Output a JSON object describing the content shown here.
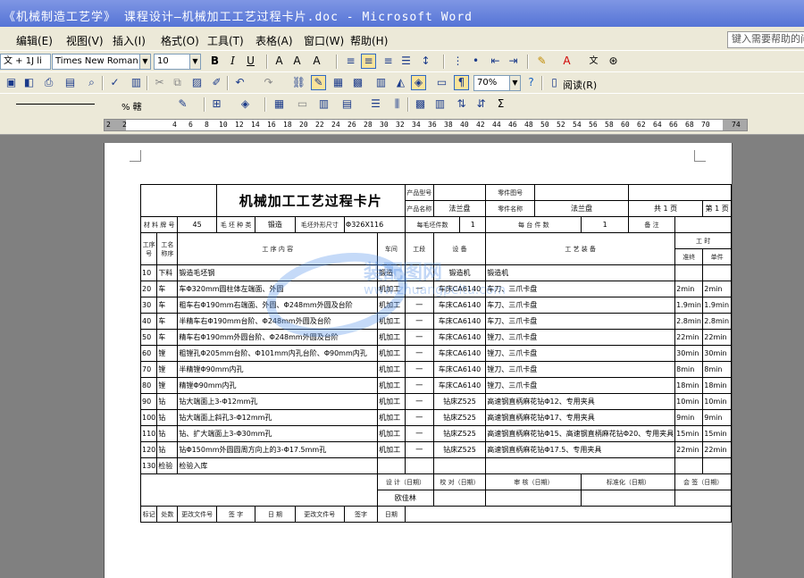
{
  "window": {
    "title": "《机械制造工艺学》 课程设计—机械加工工艺过程卡片.doc - Microsoft Word"
  },
  "menu": {
    "items": [
      "编辑(E)",
      "视图(V)",
      "插入(I)",
      "格式(O)",
      "工具(T)",
      "表格(A)",
      "窗口(W)",
      "帮助(H)"
    ],
    "help_placeholder": "键入需要帮助的问题"
  },
  "toolbar": {
    "style_value": "文 + 1J li",
    "font_value": "Times New Roman",
    "size_value": "10",
    "bold": "B",
    "italic": "I",
    "underline": "U",
    "zoom_value": "70%",
    "read_label": "阅读(R)",
    "draw_pct": "% 轄",
    "sigma": "Σ"
  },
  "ruler": {
    "ticks": [
      "2",
      "4",
      "6",
      "8",
      "10",
      "12",
      "14",
      "16",
      "18",
      "20",
      "22",
      "24",
      "26",
      "28",
      "30",
      "32",
      "34",
      "36",
      "38",
      "40",
      "42",
      "44",
      "46",
      "48",
      "50",
      "52",
      "54",
      "56",
      "58",
      "60",
      "62",
      "64",
      "66",
      "68",
      "70",
      "74"
    ]
  },
  "card": {
    "title": "机械加工工艺过程卡片",
    "product_model_label": "产品型号",
    "product_name_label": "产品名称",
    "product_name_value": "法兰盘",
    "part_no_label": "零件图号",
    "part_name_label": "零件名称",
    "part_name_value": "法兰盘",
    "total_pages": "共 1 页",
    "page_no": "第 1 页",
    "material_label": "材 料 牌 号",
    "material_value": "45",
    "blank_kind_label": "毛 坯 种 类",
    "blank_kind_value": "锻造",
    "blank_size_label": "毛坯外形尺寸",
    "blank_size_value": "Φ326X116",
    "per_blank_label": "每毛坯件数",
    "per_blank_value": "1",
    "per_unit_label": "每 台 件 数",
    "per_unit_value": "1",
    "remarks_label": "备 注",
    "col_op_no": "工序号",
    "col_op_name": "工名称序",
    "col_content": "工 序 内 容",
    "col_workshop": "车间",
    "col_section": "工段",
    "col_equipment": "设 备",
    "col_tooling": "工 艺 装 备",
    "col_hours": "工 时",
    "col_prep": "准终",
    "col_unit": "单件",
    "rows": [
      {
        "no": "10",
        "name": "下料",
        "content": "锻造毛坯钢",
        "workshop": "锻造",
        "section": "",
        "equipment": "锻造机",
        "tooling": "锻造机",
        "prep": "",
        "unit": ""
      },
      {
        "no": "20",
        "name": "车",
        "content": "车Φ320mm圆柱体左端面、外圆",
        "workshop": "机加工",
        "section": "一",
        "equipment": "车床CA6140",
        "tooling": "车刀、三爪卡盘",
        "prep": "2min",
        "unit": "2min"
      },
      {
        "no": "30",
        "name": "车",
        "content": "粗车右Φ190mm右端面、外圆、Φ248mm外圆及台阶",
        "workshop": "机加工",
        "section": "一",
        "equipment": "车床CA6140",
        "tooling": "车刀、三爪卡盘",
        "prep": "1.9min",
        "unit": "1.9min"
      },
      {
        "no": "40",
        "name": "车",
        "content": "半精车右Φ190mm台阶、Φ248mm外圆及台阶",
        "workshop": "机加工",
        "section": "一",
        "equipment": "车床CA6140",
        "tooling": "车刀、三爪卡盘",
        "prep": "2.8min",
        "unit": "2.8min"
      },
      {
        "no": "50",
        "name": "车",
        "content": "精车右Φ190mm外圆台阶、Φ248mm外圆及台阶",
        "workshop": "机加工",
        "section": "一",
        "equipment": "车床CA6140",
        "tooling": "镗刀、三爪卡盘",
        "prep": "22min",
        "unit": "22min"
      },
      {
        "no": "60",
        "name": "镗",
        "content": "粗镗孔Φ205mm台阶、Φ101mm内孔台阶、Φ90mm内孔",
        "workshop": "机加工",
        "section": "一",
        "equipment": "车床CA6140",
        "tooling": "镗刀、三爪卡盘",
        "prep": "30min",
        "unit": "30min"
      },
      {
        "no": "70",
        "name": "镗",
        "content": "半精镗Φ90mm内孔",
        "workshop": "机加工",
        "section": "一",
        "equipment": "车床CA6140",
        "tooling": "镗刀、三爪卡盘",
        "prep": "8min",
        "unit": "8min"
      },
      {
        "no": "80",
        "name": "镗",
        "content": "精镗Φ90mm内孔",
        "workshop": "机加工",
        "section": "一",
        "equipment": "车床CA6140",
        "tooling": "镗刀、三爪卡盘",
        "prep": "18min",
        "unit": "18min"
      },
      {
        "no": "90",
        "name": "钻",
        "content": "钻大端面上3-Φ12mm孔",
        "workshop": "机加工",
        "section": "一",
        "equipment": "钻床Z525",
        "tooling": "高速钢直柄麻花钻Φ12、专用夹具",
        "prep": "10min",
        "unit": "10min"
      },
      {
        "no": "100",
        "name": "钻",
        "content": "钻大端面上斜孔3-Φ12mm孔",
        "workshop": "机加工",
        "section": "一",
        "equipment": "钻床Z525",
        "tooling": "高速钢直柄麻花钻Φ17、专用夹具",
        "prep": "9min",
        "unit": "9min"
      },
      {
        "no": "110",
        "name": "钻",
        "content": "钻、扩大端面上3-Φ30mm孔",
        "workshop": "机加工",
        "section": "一",
        "equipment": "钻床Z525",
        "tooling": "高速钢直柄麻花钻Φ15、高速钢直柄麻花钻Φ20、专用夹具",
        "prep": "15min",
        "unit": "15min"
      },
      {
        "no": "120",
        "name": "钻",
        "content": "钻Φ150mm外圆圆周方向上的3-Φ17.5mm孔",
        "workshop": "机加工",
        "section": "一",
        "equipment": "钻床Z525",
        "tooling": "高速钢直柄麻花钻Φ17.5、专用夹具",
        "prep": "22min",
        "unit": "22min"
      },
      {
        "no": "130",
        "name": "检验",
        "content": "检验入库",
        "workshop": "",
        "section": "",
        "equipment": "",
        "tooling": "",
        "prep": "",
        "unit": ""
      }
    ],
    "sign_design": "设 计（日期）",
    "sign_proof": "校 对（日期）",
    "sign_review": "审 核（日期）",
    "sign_std": "标准化（日期）",
    "sign_sign": "会 签（日期）",
    "author": "欧佳林",
    "foot_mark": "标记",
    "foot_count": "处数",
    "foot_docno": "更改文件号",
    "foot_sign": "签 字",
    "foot_date": "日 期",
    "foot_sign2": "签字",
    "foot_date2": "日期"
  },
  "watermark": {
    "text": "装配图网",
    "url": "www.zhuangpeitu.com"
  }
}
